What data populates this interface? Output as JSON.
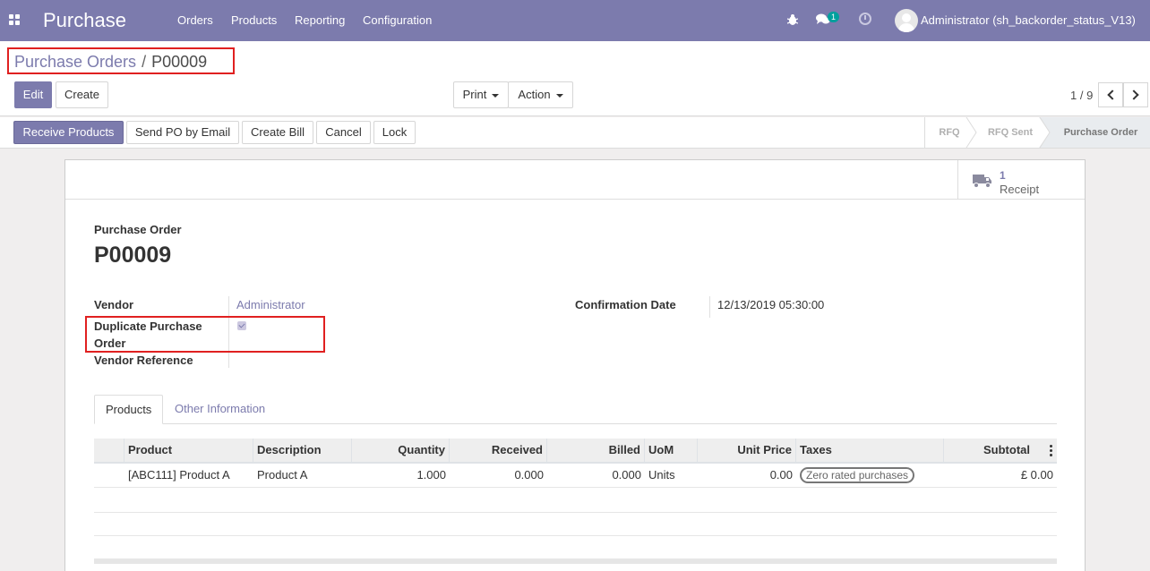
{
  "navbar": {
    "app_title": "Purchase",
    "menu": [
      "Orders",
      "Products",
      "Reporting",
      "Configuration"
    ],
    "chat_count": "1",
    "user": "Administrator (sh_backorder_status_V13)"
  },
  "breadcrumb": {
    "parent": "Purchase Orders",
    "separator": "/",
    "current": "P00009"
  },
  "control": {
    "edit_label": "Edit",
    "create_label": "Create",
    "print_label": "Print",
    "action_label": "Action",
    "pager": "1 / 9"
  },
  "statusbar": {
    "buttons": [
      "Receive Products",
      "Send PO by Email",
      "Create Bill",
      "Cancel",
      "Lock"
    ],
    "stages": [
      "RFQ",
      "RFQ Sent",
      "Purchase Order"
    ],
    "active_stage": "Purchase Order"
  },
  "smart_button": {
    "count": "1",
    "label": "Receipt"
  },
  "form": {
    "title_label": "Purchase Order",
    "name": "P00009",
    "vendor_label": "Vendor",
    "vendor_value": "Administrator",
    "duplicate_label_line1": "Duplicate Purchase",
    "duplicate_label_line2": "Order",
    "duplicate_checked": true,
    "vendor_ref_label": "Vendor Reference",
    "confirmation_label": "Confirmation Date",
    "confirmation_value": "12/13/2019 05:30:00"
  },
  "tabs": [
    "Products",
    "Other Information"
  ],
  "table": {
    "headers": [
      "Product",
      "Description",
      "Quantity",
      "Received",
      "Billed",
      "UoM",
      "Unit Price",
      "Taxes",
      "Subtotal"
    ],
    "rows": [
      {
        "product": "[ABC111] Product A",
        "description": "Product A",
        "quantity": "1.000",
        "received": "0.000",
        "billed": "0.000",
        "uom": "Units",
        "unit_price": "0.00",
        "taxes": "Zero rated purchases",
        "subtotal": "£ 0.00"
      }
    ]
  },
  "colors": {
    "brand": "#7c7bad",
    "highlight": "#e02020"
  }
}
